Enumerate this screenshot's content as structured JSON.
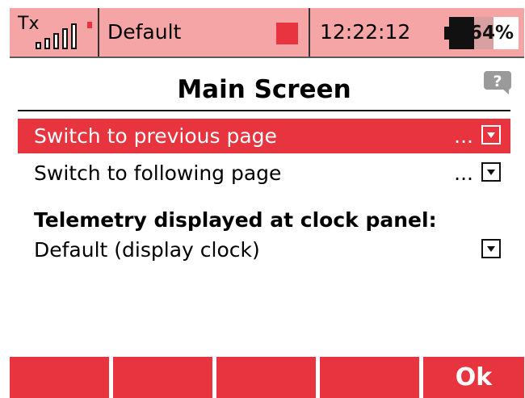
{
  "status_bar": {
    "tx_label": "Tx",
    "signal_icon": "signal-bars-icon",
    "model_name": "Default",
    "time": "12:22:12",
    "battery_percent": "64%",
    "battery_level": 0.64
  },
  "header": {
    "title": "Main Screen",
    "help_icon": "help-icon"
  },
  "rows": [
    {
      "label": "Switch to previous page",
      "value": "...",
      "selected": true
    },
    {
      "label": "Switch to following page",
      "value": "...",
      "selected": false
    }
  ],
  "telemetry": {
    "section_title": "Telemetry displayed at clock panel:",
    "value": "Default (display clock)"
  },
  "softkeys": [
    "",
    "",
    "",
    "",
    "Ok"
  ],
  "colors": {
    "accent_red": "#e8343f",
    "status_bar_pink": "#f5a5a6",
    "text": "#000000"
  }
}
